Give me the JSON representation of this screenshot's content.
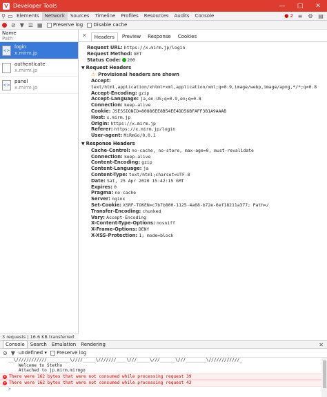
{
  "window": {
    "title": "Developer Tools",
    "logo": "V"
  },
  "tabs": [
    "Elements",
    "Network",
    "Sources",
    "Timeline",
    "Profiles",
    "Resources",
    "Audits",
    "Console"
  ],
  "error_count": "2",
  "toolbar": {
    "preserve_log": "Preserve log",
    "disable_cache": "Disable cache"
  },
  "list_header": {
    "name": "Name",
    "path": "Path"
  },
  "requests": [
    {
      "name": "login",
      "host": "x.mirm.jp"
    },
    {
      "name": "authenticate",
      "host": "x.mirm.jp"
    },
    {
      "name": "panel",
      "host": "x.mirm.jp"
    }
  ],
  "footer_status": "3 requests | 16.6 KB transferred",
  "detail_tabs": [
    "Headers",
    "Preview",
    "Response",
    "Cookies"
  ],
  "general": {
    "url_key": "Request URL:",
    "url_val": "https://x.mirm.jp/login",
    "method_key": "Request Method:",
    "method_val": "GET",
    "status_key": "Status Code:",
    "status_val": "200"
  },
  "request_headers_title": "Request Headers",
  "provisional_note": "Provisional headers are shown",
  "request_headers": [
    {
      "k": "Accept:",
      "v": "text/html,application/xhtml+xml,application/xml;q=0.9,image/webp,image/apng,*/*;q=0.8"
    },
    {
      "k": "Accept-Encoding:",
      "v": "gzip"
    },
    {
      "k": "Accept-Language:",
      "v": "ja,en-US;q=0.9,en;q=0.8"
    },
    {
      "k": "Connection:",
      "v": "keep-alive"
    },
    {
      "k": "Cookie:",
      "v": "JSESSIONID=80886EE8B54EE4DD56BFAFF3B1A9AAAB"
    },
    {
      "k": "Host:",
      "v": "x.mirm.jp"
    },
    {
      "k": "Origin:",
      "v": "https://x.mirm.jp"
    },
    {
      "k": "Referer:",
      "v": "https://x.mirm.jp/login"
    },
    {
      "k": "User-agent:",
      "v": "MiRmGo/0.0.1"
    }
  ],
  "response_headers_title": "Response Headers",
  "response_headers": [
    {
      "k": "Cache-Control:",
      "v": "no-cache, no-store, max-age=0, must-revalidate"
    },
    {
      "k": "Connection:",
      "v": "keep-alive"
    },
    {
      "k": "Content-Encoding:",
      "v": "gzip"
    },
    {
      "k": "Content-Language:",
      "v": "ja"
    },
    {
      "k": "Content-Type:",
      "v": "text/html;charset=UTF-8"
    },
    {
      "k": "Date:",
      "v": "Sat, 25 Apr 2020 15:42:15 GMT"
    },
    {
      "k": "Expires:",
      "v": "0"
    },
    {
      "k": "Pragma:",
      "v": "no-cache"
    },
    {
      "k": "Server:",
      "v": "nginx"
    },
    {
      "k": "Set-Cookie:",
      "v": "XSRF-TOKEN=c7b7b800-1125-4a68-b72e-6ef18211a377; Path=/"
    },
    {
      "k": "Transfer-Encoding:",
      "v": "chunked"
    },
    {
      "k": "Vary:",
      "v": "Accept-Encoding"
    },
    {
      "k": "X-Content-Type-Options:",
      "v": "nosniff"
    },
    {
      "k": "X-Frame-Options:",
      "v": "DENY"
    },
    {
      "k": "X-XSS-Protection:",
      "v": "1; mode=block"
    }
  ],
  "drawer_tabs": [
    "Console",
    "Search",
    "Emulation",
    "Rendering"
  ],
  "console_toolbar": {
    "context": "undefined",
    "preserve_log": "Preserve log"
  },
  "console_lines": [
    "__\\////////////_________\\////_____\\///////____\\///_____\\///______\\///________\\////////////_",
    "    Welcome to Stetho",
    "    Attached to jp.mirm.mirmgo"
  ],
  "console_errors": [
    {
      "text": "There were 162 bytes that were not consumed while processing request 39",
      "src": ""
    },
    {
      "text": "There were 162 bytes that were not consumed while processing request 43",
      "src": ""
    }
  ],
  "colors": {
    "titlebar": "#dd3c2e",
    "selected_row": "#3879d9",
    "error": "#dd0000",
    "status_ok": "#1ba81b"
  }
}
